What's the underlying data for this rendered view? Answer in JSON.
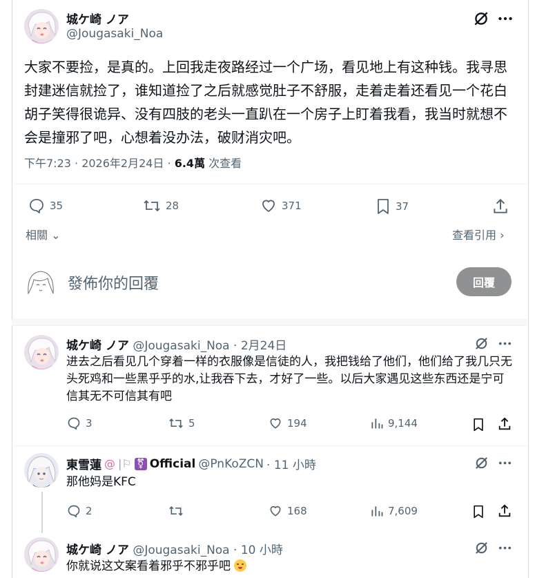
{
  "main_post": {
    "display_name": "城ケ崎 ノア",
    "handle": "@Jougasaki_Noa",
    "text": "大家不要捡，是真的。上回我走夜路经过一个广场，看见地上有这种钱。我寻思封建迷信就捡了，谁知道捡了之后就感觉肚子不舒服，走着走着还看见一个花白胡子笑得很诡异、没有四肢的老头一直趴在一个房子上盯着我看，我当时就想不会是撞邪了吧，心想着没办法，破财消灾吧。",
    "time": "下午7:23 · 2026年2月24日 ·",
    "views": "6.4萬",
    "views_label": "次查看",
    "replies": "35",
    "reposts": "28",
    "likes": "371",
    "bookmarks": "37",
    "related_label": "相關",
    "quotes_label": "查看引用"
  },
  "composer": {
    "placeholder": "發佈你的回覆",
    "reply_button": "回覆"
  },
  "replies": [
    {
      "display_name": "城ケ崎 ノア",
      "handle": "@Jougasaki_Noa",
      "time": "· 2月24日",
      "text": "进去之后看见几个穿着一样的衣服像是信徒的人，我把钱给了他们，他们给了我几只无头死鸡和一些黑乎乎的水,让我吞下去，才好了一些。以后大家遇见这些东西还是宁可信其无不可信其有吧",
      "replies": "3",
      "reposts": "5",
      "likes": "194",
      "views": "9,144"
    },
    {
      "display_name": "東雪蓮",
      "badge": "Official",
      "handle": "@PnKoZCN",
      "time": "· 11 小時",
      "text": "那他妈是KFC",
      "replies": "2",
      "reposts": "",
      "likes": "168",
      "views": "7,609"
    },
    {
      "display_name": "城ケ崎 ノア",
      "handle": "@Jougasaki_Noa",
      "time": "· 10 小時",
      "text": "你就说这文案看着邪乎不邪乎吧"
    }
  ],
  "colors": {
    "text": "#0f1419",
    "muted": "#536471",
    "border": "#cfd9de",
    "badge_purple": "#8b4fb5",
    "reply_button_bg": "#8f9193"
  }
}
